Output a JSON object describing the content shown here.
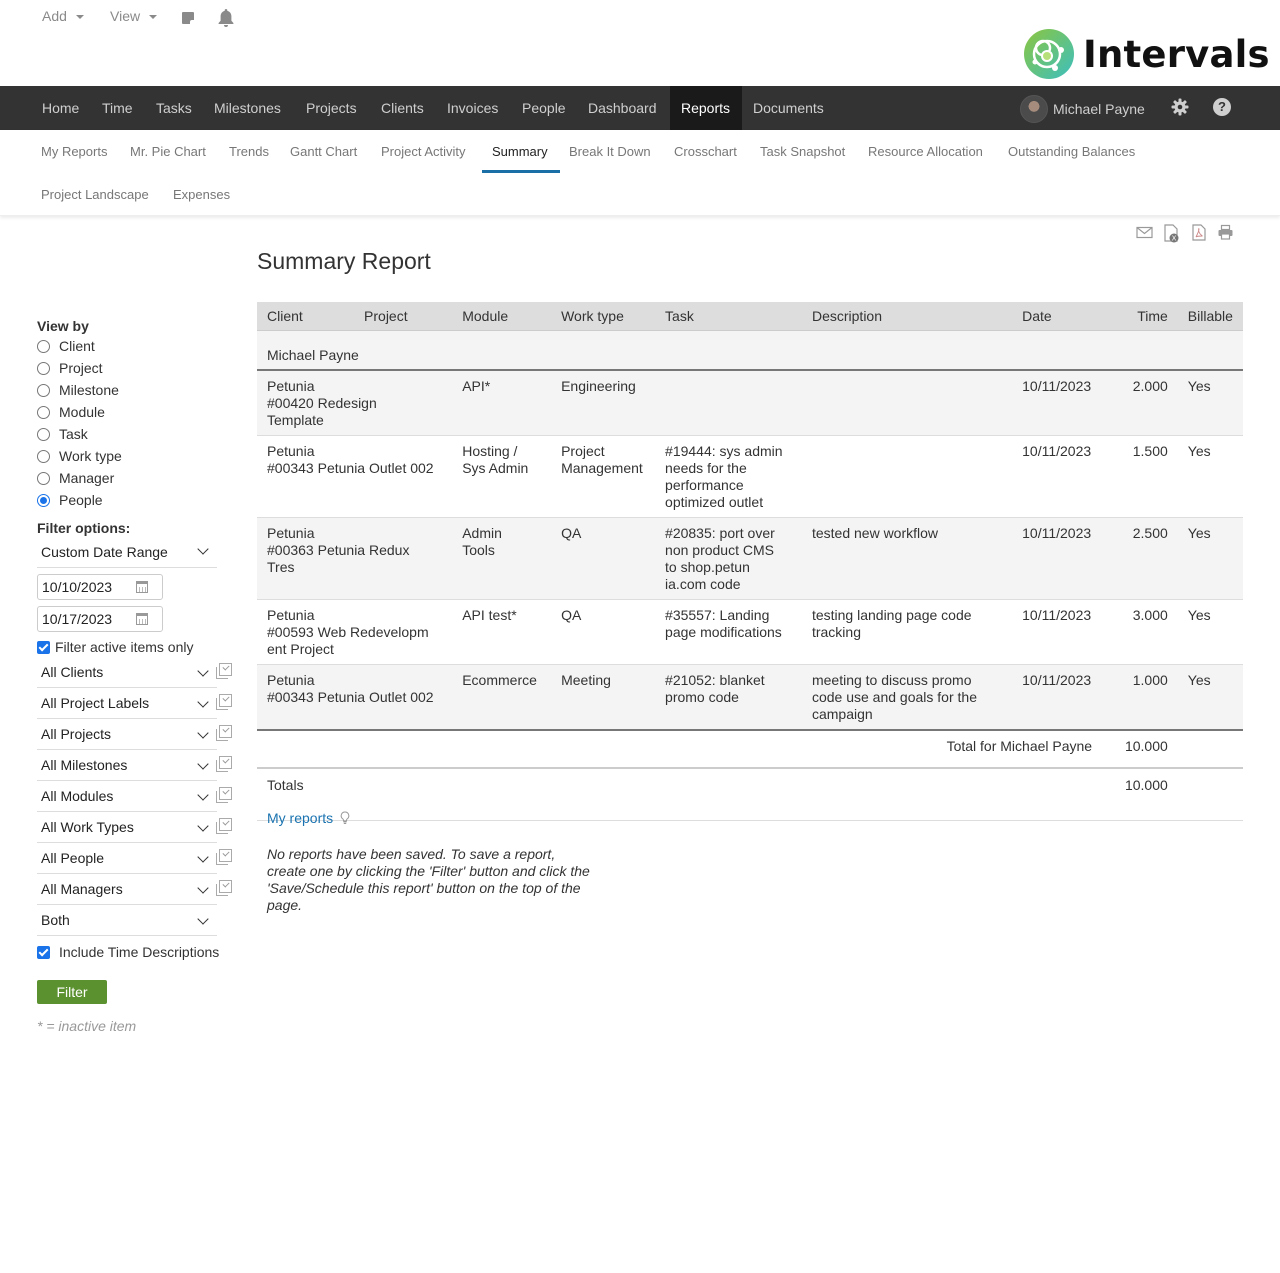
{
  "topbar": {
    "add_label": "Add",
    "view_label": "View",
    "icons": [
      "note-icon",
      "bell-icon"
    ]
  },
  "brand": {
    "name": "Intervals",
    "colors": {
      "logo_green": "#8cc63f",
      "logo_teal": "#3cbfbf"
    }
  },
  "main_nav": {
    "items": [
      {
        "label": "Home"
      },
      {
        "label": "Time"
      },
      {
        "label": "Tasks"
      },
      {
        "label": "Milestones"
      },
      {
        "label": "Projects"
      },
      {
        "label": "Clients"
      },
      {
        "label": "Invoices"
      },
      {
        "label": "People"
      },
      {
        "label": "Dashboard"
      },
      {
        "label": "Reports",
        "active": true
      },
      {
        "label": "Documents"
      }
    ],
    "user_name": "Michael Payne",
    "icons": [
      "gear-icon",
      "help-icon"
    ]
  },
  "sub_nav": {
    "items": [
      {
        "label": "My Reports"
      },
      {
        "label": "Mr. Pie Chart"
      },
      {
        "label": "Trends"
      },
      {
        "label": "Gantt Chart"
      },
      {
        "label": "Project Activity"
      },
      {
        "label": "Summary",
        "active": true
      },
      {
        "label": "Break It Down"
      },
      {
        "label": "Crosschart"
      },
      {
        "label": "Task Snapshot"
      },
      {
        "label": "Resource Allocation"
      },
      {
        "label": "Outstanding Balances"
      },
      {
        "label": "Project Landscape"
      },
      {
        "label": "Expenses"
      }
    ],
    "accent_color": "#1a6fa6"
  },
  "export_icons": [
    "email-icon",
    "excel-icon",
    "pdf-icon",
    "print-icon"
  ],
  "page_title": "Summary Report",
  "sidebar": {
    "view_by_label": "View by",
    "view_by_options": [
      {
        "label": "Client",
        "checked": false
      },
      {
        "label": "Project",
        "checked": false
      },
      {
        "label": "Milestone",
        "checked": false
      },
      {
        "label": "Module",
        "checked": false
      },
      {
        "label": "Task",
        "checked": false
      },
      {
        "label": "Work type",
        "checked": false
      },
      {
        "label": "Manager",
        "checked": false
      },
      {
        "label": "People",
        "checked": true
      }
    ],
    "filter_options_label": "Filter options:",
    "date_range": "Custom Date Range",
    "start_date": "10/10/2023",
    "end_date": "10/17/2023",
    "filter_active_label": "Filter active items only",
    "filter_active_checked": true,
    "selects": [
      {
        "value": "All Clients"
      },
      {
        "value": "All Project Labels"
      },
      {
        "value": "All Projects"
      },
      {
        "value": "All Milestones"
      },
      {
        "value": "All Modules"
      },
      {
        "value": "All Work Types"
      },
      {
        "value": "All People"
      },
      {
        "value": "All Managers"
      }
    ],
    "billable_select": "Both",
    "include_desc_label": "Include Time Descriptions",
    "include_desc_checked": true,
    "filter_button": "Filter",
    "filter_button_color": "#5c912f",
    "inactive_note": "* = inactive item"
  },
  "report": {
    "columns": [
      "Client",
      "Project",
      "Module",
      "Work type",
      "Task",
      "Description",
      "Date",
      "Time",
      "Billable"
    ],
    "group_name": "Michael Payne",
    "rows": [
      {
        "client_project": "Petunia\n#00420 Redesign\nTemplate",
        "module": "API*",
        "work_type": "Engineering",
        "task": "",
        "description": "",
        "date": "10/11/2023",
        "time": "2.000",
        "billable": "Yes"
      },
      {
        "client_project": "Petunia\n#00343 Petunia Outlet 002",
        "module": "Hosting /\nSys Admin",
        "work_type": "Project\nManagement",
        "task": "#19444: sys admin\nneeds for the\nperformance\noptimized outlet",
        "description": "",
        "date": "10/11/2023",
        "time": "1.500",
        "billable": "Yes"
      },
      {
        "client_project": "Petunia\n#00363 Petunia Redux\nTres",
        "module": "Admin\nTools",
        "work_type": "QA",
        "task": "#20835: port over\nnon product CMS\nto shop.petun\nia.com code",
        "description": "tested new workflow",
        "date": "10/11/2023",
        "time": "2.500",
        "billable": "Yes"
      },
      {
        "client_project": "Petunia\n#00593 Web Redevelopm\nent Project",
        "module": "API test*",
        "work_type": "QA",
        "task": "#35557: Landing\npage modifications",
        "description": "testing landing page code\ntracking",
        "date": "10/11/2023",
        "time": "3.000",
        "billable": "Yes"
      },
      {
        "client_project": "Petunia\n#00343 Petunia Outlet 002",
        "module": "Ecommerce",
        "work_type": "Meeting",
        "task": "#21052: blanket\npromo code",
        "description": "meeting to discuss promo\ncode use and goals for the\ncampaign",
        "date": "10/11/2023",
        "time": "1.000",
        "billable": "Yes"
      }
    ],
    "subtotal_label": "Total for Michael Payne",
    "subtotal_value": "10.000",
    "totals_label": "Totals",
    "totals_value": "10.000"
  },
  "my_reports": {
    "link_label": "My reports",
    "empty_message": "No reports have been saved. To save a report, create one by clicking the 'Filter' button and click the 'Save/Schedule this report' button on the top of the page."
  }
}
